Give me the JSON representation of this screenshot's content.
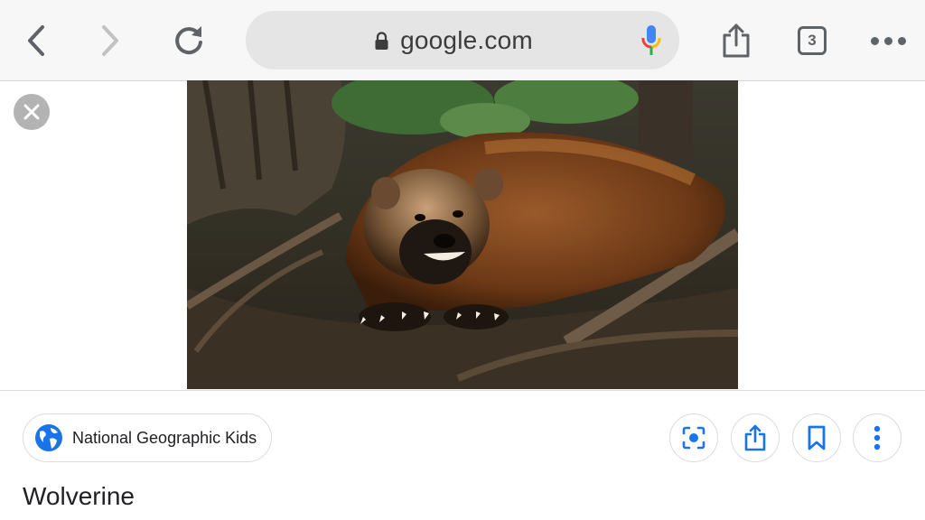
{
  "browser": {
    "url": "google.com",
    "tab_count": "3",
    "icons": [
      "back-icon",
      "forward-icon",
      "reload-icon",
      "lock-icon",
      "mic-icon",
      "share-icon",
      "tabs-icon",
      "more-icon"
    ]
  },
  "viewer": {
    "close_icon": "close-icon",
    "image_subject": "wolverine photo"
  },
  "result": {
    "source": "National Geographic Kids",
    "title": "Wolverine",
    "actions": [
      "lens-icon",
      "share-icon",
      "bookmark-icon",
      "more-vert-icon"
    ]
  },
  "colors": {
    "accent_blue": "#1a73e8",
    "icon_gray": "#5f6368",
    "omnibox_bg": "#e5e5e5"
  }
}
